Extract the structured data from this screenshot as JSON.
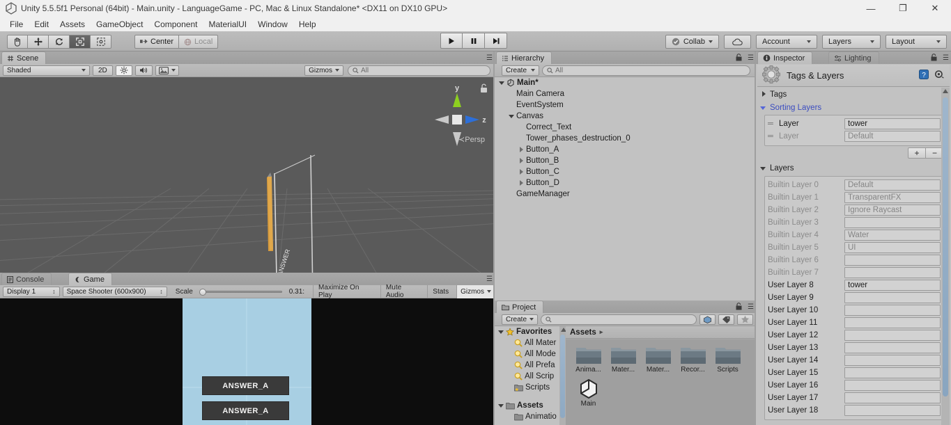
{
  "window": {
    "title": "Unity 5.5.5f1 Personal (64bit) - Main.unity - LanguageGame - PC, Mac & Linux Standalone* <DX11 on DX10 GPU>",
    "minimize": "—",
    "maximize": "❐",
    "close": "✕"
  },
  "menu": {
    "items": [
      "File",
      "Edit",
      "Assets",
      "GameObject",
      "Component",
      "MaterialUI",
      "Window",
      "Help"
    ]
  },
  "toolbar": {
    "tools": [
      "hand-tool",
      "move-tool",
      "rotate-tool",
      "scale-tool",
      "rect-tool"
    ],
    "pivot_label": "Center",
    "space_label": "Local",
    "play": "▶",
    "pause": "❚❚",
    "step": "▶|",
    "collab_label": "Collab",
    "cloud_label": "",
    "account_label": "Account",
    "layers_label": "Layers",
    "layout_label": "Layout"
  },
  "scene": {
    "tab_label": "Scene",
    "shading_mode": "Shaded",
    "mode_2d": "2D",
    "gizmos_label": "Gizmos",
    "search_placeholder": "All",
    "axis_y": "y",
    "axis_z": "z",
    "persp_label": "Persp",
    "scene_bg": "#5a5a5a"
  },
  "game": {
    "console_tab": "Console",
    "game_tab": "Game",
    "display": "Display 1",
    "aspect": "Space Shooter (600x900)",
    "scale_label": "Scale",
    "scale_value": "0.31:",
    "maximize_on_play": "Maximize On Play",
    "mute_audio": "Mute Audio",
    "stats": "Stats",
    "gizmos": "Gizmos",
    "bg_color": "#a8cfe3",
    "buttons": [
      "ANSWER_A",
      "ANSWER_A"
    ]
  },
  "hierarchy": {
    "tab_label": "Hierarchy",
    "create_label": "Create",
    "search_placeholder": "All",
    "items": [
      {
        "label": "Main*",
        "indent": 0,
        "arrow": "down",
        "root": true
      },
      {
        "label": "Main Camera",
        "indent": 1,
        "arrow": "none",
        "root": false
      },
      {
        "label": "EventSystem",
        "indent": 1,
        "arrow": "none",
        "root": false
      },
      {
        "label": "Canvas",
        "indent": 1,
        "arrow": "down",
        "root": false
      },
      {
        "label": "Correct_Text",
        "indent": 2,
        "arrow": "none",
        "root": false
      },
      {
        "label": "Tower_phases_destruction_0",
        "indent": 2,
        "arrow": "none",
        "root": false
      },
      {
        "label": "Button_A",
        "indent": 2,
        "arrow": "right",
        "root": false
      },
      {
        "label": "Button_B",
        "indent": 2,
        "arrow": "right",
        "root": false
      },
      {
        "label": "Button_C",
        "indent": 2,
        "arrow": "right",
        "root": false
      },
      {
        "label": "Button_D",
        "indent": 2,
        "arrow": "right",
        "root": false
      },
      {
        "label": "GameManager",
        "indent": 1,
        "arrow": "none",
        "root": false
      }
    ]
  },
  "project": {
    "tab_label": "Project",
    "create_label": "Create",
    "search_placeholder": "",
    "breadcrumb": "Assets",
    "tree": [
      {
        "label": "Favorites",
        "indent": 0,
        "arrow": "down",
        "icon": "star",
        "bold": true
      },
      {
        "label": "All Mater",
        "indent": 1,
        "arrow": "none",
        "icon": "search",
        "bold": false
      },
      {
        "label": "All Mode",
        "indent": 1,
        "arrow": "none",
        "icon": "search",
        "bold": false
      },
      {
        "label": "All Prefa",
        "indent": 1,
        "arrow": "none",
        "icon": "search",
        "bold": false
      },
      {
        "label": "All Scrip",
        "indent": 1,
        "arrow": "none",
        "icon": "search",
        "bold": false
      },
      {
        "label": "Scripts",
        "indent": 1,
        "arrow": "none",
        "icon": "fav-folder",
        "bold": false
      },
      {
        "label": "",
        "indent": 0,
        "arrow": "none",
        "icon": "none",
        "bold": false
      },
      {
        "label": "Assets",
        "indent": 0,
        "arrow": "down",
        "icon": "folder",
        "bold": true
      },
      {
        "label": "Animatio",
        "indent": 1,
        "arrow": "none",
        "icon": "folder",
        "bold": false
      }
    ],
    "assets": [
      {
        "label": "Anima...",
        "type": "folder"
      },
      {
        "label": "Mater...",
        "type": "folder"
      },
      {
        "label": "Mater...",
        "type": "folder"
      },
      {
        "label": "Recor...",
        "type": "folder"
      },
      {
        "label": "Scripts",
        "type": "folder"
      },
      {
        "label": "Main",
        "type": "scene"
      }
    ]
  },
  "inspector": {
    "tab_label": "Inspector",
    "lighting_tab_label": "Lighting",
    "title": "Tags & Layers",
    "tags_foldout": "Tags",
    "sorting_layers_foldout": "Sorting Layers",
    "layers_foldout": "Layers",
    "sorting_layers": [
      {
        "label": "Layer",
        "value": "tower",
        "dim": false
      },
      {
        "label": "Layer",
        "value": "Default",
        "dim": true
      }
    ],
    "add_button": "+",
    "remove_button": "−",
    "layers": [
      {
        "label": "Builtin Layer 0",
        "value": "Default",
        "dim": true
      },
      {
        "label": "Builtin Layer 1",
        "value": "TransparentFX",
        "dim": true
      },
      {
        "label": "Builtin Layer 2",
        "value": "Ignore Raycast",
        "dim": true
      },
      {
        "label": "Builtin Layer 3",
        "value": "",
        "dim": true
      },
      {
        "label": "Builtin Layer 4",
        "value": "Water",
        "dim": true
      },
      {
        "label": "Builtin Layer 5",
        "value": "UI",
        "dim": true
      },
      {
        "label": "Builtin Layer 6",
        "value": "",
        "dim": true
      },
      {
        "label": "Builtin Layer 7",
        "value": "",
        "dim": true
      },
      {
        "label": "User Layer 8",
        "value": "tower",
        "dim": false
      },
      {
        "label": "User Layer 9",
        "value": "",
        "dim": false
      },
      {
        "label": "User Layer 10",
        "value": "",
        "dim": false
      },
      {
        "label": "User Layer 11",
        "value": "",
        "dim": false
      },
      {
        "label": "User Layer 12",
        "value": "",
        "dim": false
      },
      {
        "label": "User Layer 13",
        "value": "",
        "dim": false
      },
      {
        "label": "User Layer 14",
        "value": "",
        "dim": false
      },
      {
        "label": "User Layer 15",
        "value": "",
        "dim": false
      },
      {
        "label": "User Layer 16",
        "value": "",
        "dim": false
      },
      {
        "label": "User Layer 17",
        "value": "",
        "dim": false
      },
      {
        "label": "User Layer 18",
        "value": "",
        "dim": false
      }
    ]
  }
}
